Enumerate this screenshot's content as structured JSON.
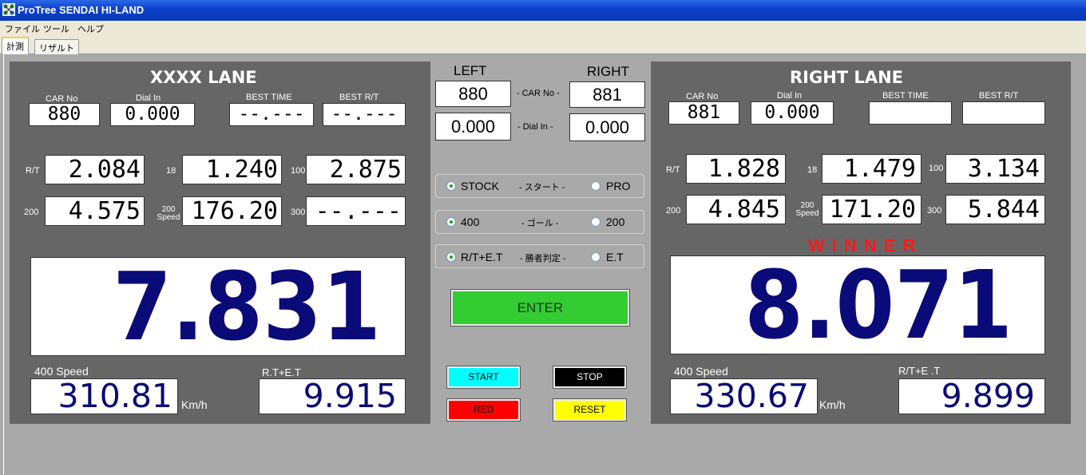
{
  "window": {
    "title": "ProTree SENDAI HI-LAND"
  },
  "menu": [
    "ファイル",
    "ツール",
    "ヘルプ"
  ],
  "tabs": [
    "計測",
    "リザルト"
  ],
  "left_lane": {
    "title": "XXXX LANE",
    "car_no_label": "CAR No",
    "car_no": "880",
    "dial_in_label": "Dial In",
    "dial_in": "0.000",
    "best_time_label": "BEST TIME",
    "best_time": "--.---",
    "best_rt_label": "BEST R/T",
    "best_rt": "--.---",
    "rt_label": "R/T",
    "rt": "2.084",
    "s18_label": "18",
    "s18": "1.240",
    "s100_label": "100",
    "s100": "2.875",
    "s200_label": "200",
    "s200": "4.575",
    "speed200_label_1": "200",
    "speed200_label_2": "Speed",
    "speed200": "176.20",
    "s300_label": "300",
    "s300": "--.---",
    "et": "7.831",
    "speed400_label": "400 Speed",
    "speed400": "310.81",
    "speed_unit": "Km/h",
    "rtet_label": "R.T+E.T",
    "rtet": "9.915"
  },
  "right_lane": {
    "title": "RIGHT LANE",
    "car_no_label": "CAR No",
    "car_no": "881",
    "dial_in_label": "Dial In",
    "dial_in": "0.000",
    "best_time_label": "BEST TIME",
    "best_time": "",
    "best_rt_label": "BEST R/T",
    "best_rt": "",
    "rt_label": "R/T",
    "rt": "1.828",
    "s18_label": "18",
    "s18": "1.479",
    "s100_label": "100",
    "s100": "3.134",
    "s200_label": "200",
    "s200": "4.845",
    "speed200_label_1": "200",
    "speed200_label_2": "Speed",
    "speed200": "171.20",
    "s300_label": "300",
    "s300": "5.844",
    "winner": "WINNER",
    "et": "8.071",
    "speed400_label": "400 Speed",
    "speed400": "330.67",
    "speed_unit": "Km/h",
    "rtet_label": "R/T+E .T",
    "rtet": "9.899"
  },
  "center": {
    "left_label": "LEFT",
    "right_label": "RIGHT",
    "left_car": "880",
    "right_car": "881",
    "car_no_label": "- CAR No -",
    "left_dial": "0.000",
    "right_dial": "0.000",
    "dial_in_label": "- Dial In -",
    "start_group": {
      "option_a": "STOCK",
      "label": "- スタート -",
      "option_b": "PRO",
      "selected": "STOCK"
    },
    "goal_group": {
      "option_a": "400",
      "label": "- ゴール -",
      "option_b": "200",
      "selected": "400"
    },
    "judge_group": {
      "option_a": "R/T+E.T",
      "label": "- 勝者判定 -",
      "option_b": "E.T",
      "selected": "R/T+E.T"
    },
    "enter_label": "ENTER",
    "start_label": "START",
    "stop_label": "STOP",
    "red_label": "RED",
    "reset_label": "RESET"
  },
  "colors": {
    "panel": "#666666",
    "digits": "#0a0a78",
    "winner": "#ff1a1a",
    "enter": "#33cc33",
    "start": "#00ffff",
    "stop": "#000000",
    "red": "#ff0000",
    "reset": "#ffff00"
  }
}
